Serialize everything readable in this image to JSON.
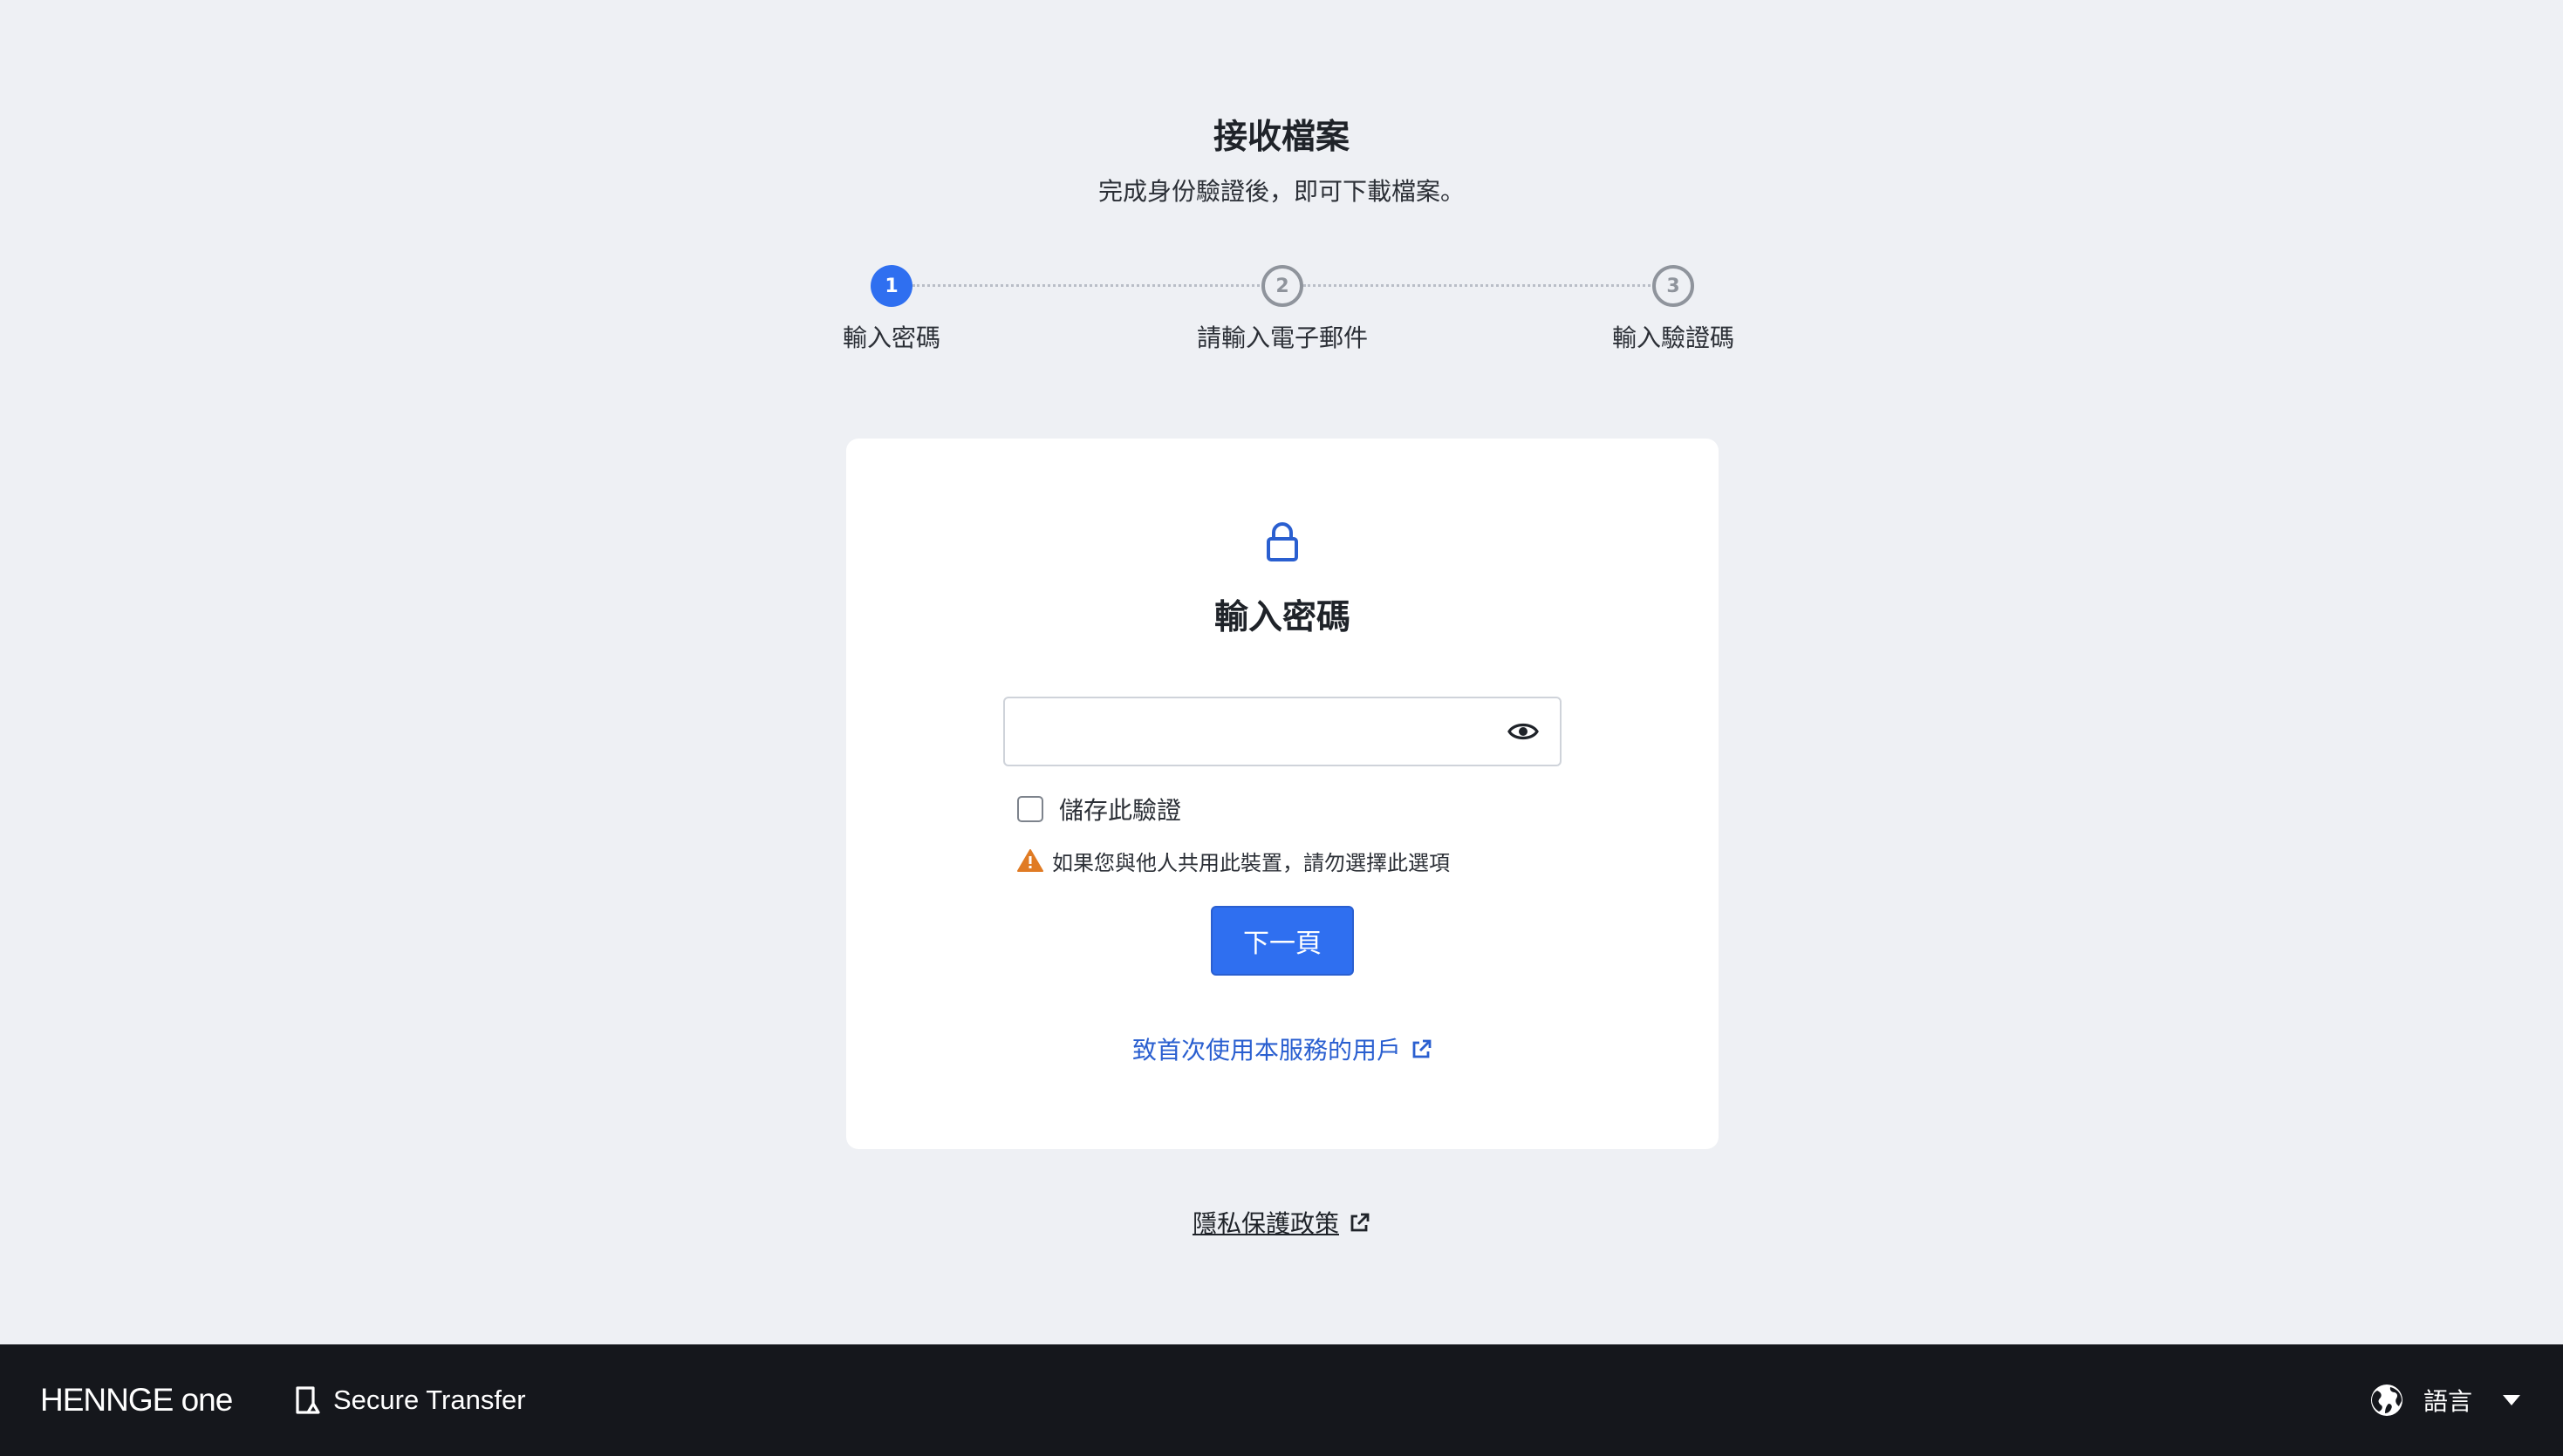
{
  "header": {
    "title": "接收檔案",
    "subtitle": "完成身份驗證後，即可下載檔案。"
  },
  "stepper": {
    "steps": [
      {
        "number": "1",
        "label": "輸入密碼",
        "state": "active"
      },
      {
        "number": "2",
        "label": "請輸入電子郵件",
        "state": "inactive"
      },
      {
        "number": "3",
        "label": "輸入驗證碼",
        "state": "inactive"
      }
    ]
  },
  "card": {
    "icon": "lock-icon",
    "title": "輸入密碼",
    "password_value": "",
    "remember_label": "儲存此驗證",
    "remember_checked": false,
    "warning_text": "如果您與他人共用此裝置，請勿選擇此選項",
    "next_button_label": "下一頁",
    "first_time_link": "致首次使用本服務的用戶"
  },
  "privacy_link": "隱私保護政策",
  "footer": {
    "brand": "HENNGE one",
    "product": "Secure Transfer",
    "language_label": "語言"
  },
  "colors": {
    "accent": "#2f6ff0",
    "link": "#2a5fd0",
    "warning": "#e07b24",
    "footer_bg": "#15171c",
    "page_bg": "#eef0f4"
  }
}
